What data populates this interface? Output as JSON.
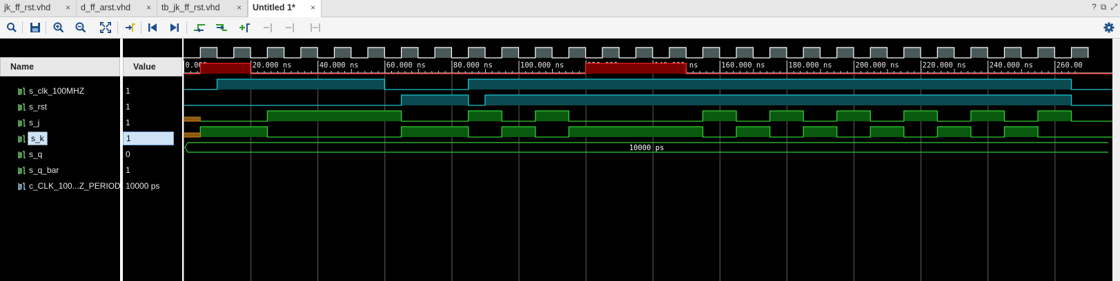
{
  "tabs": [
    {
      "label": "jk_ff_rst.vhd",
      "close": "×"
    },
    {
      "label": "d_ff_arst.vhd",
      "close": "×"
    },
    {
      "label": "tb_jk_ff_rst.vhd",
      "close": "×"
    },
    {
      "label": "Untitled 1*",
      "close": "×"
    }
  ],
  "window_controls": {
    "help": "?",
    "restore": "⧉",
    "float": "⤢"
  },
  "toolbar_icons": [
    "search-icon",
    "save-icon",
    "zoom-in-icon",
    "zoom-out-icon",
    "zoom-fit-icon",
    "go-to-cursor-icon",
    "go-to-start-icon",
    "go-to-end-icon",
    "previous-transition-icon",
    "next-transition-icon",
    "add-marker-icon",
    "previous-marker-icon",
    "next-marker-icon",
    "swap-cursors-icon",
    "settings-gear-icon"
  ],
  "columns": {
    "name": "Name",
    "value": "Value"
  },
  "signals": [
    {
      "name": "s_clk_100MHZ",
      "value": "1"
    },
    {
      "name": "s_rst",
      "value": "1"
    },
    {
      "name": "s_j",
      "value": "1"
    },
    {
      "name": "s_k",
      "value": "1"
    },
    {
      "name": "s_q",
      "value": "0"
    },
    {
      "name": "s_q_bar",
      "value": "1"
    },
    {
      "name": "c_CLK_100...Z_PERIOD",
      "value": "10000 ps"
    }
  ],
  "timeline": {
    "unit": "ns",
    "ticks": [
      "0.000 ns",
      "20.000 ns",
      "40.000 ns",
      "60.000 ns",
      "80.000 ns",
      "100.000 ns",
      "120.000 ns",
      "140.000 ns",
      "160.000 ns",
      "180.000 ns",
      "200.000 ns",
      "220.000 ns",
      "240.000 ns",
      "260.00"
    ],
    "tick_values": [
      0,
      20,
      40,
      60,
      80,
      100,
      120,
      140,
      160,
      180,
      200,
      220,
      240,
      260
    ],
    "visible_range_ns": [
      0,
      265
    ]
  },
  "waveforms": {
    "clock_period_ns": 10,
    "s_rst_high_ns": [
      [
        5,
        20
      ],
      [
        120,
        150
      ]
    ],
    "s_j_high_ns": [
      [
        10,
        60
      ],
      [
        85,
        265
      ]
    ],
    "s_k_high_ns": [
      [
        65,
        85
      ],
      [
        90,
        265
      ]
    ],
    "s_q_high_ns": [
      [
        25,
        65
      ],
      [
        85,
        95
      ],
      [
        105,
        115
      ],
      [
        155,
        165
      ],
      [
        175,
        185
      ],
      [
        195,
        205
      ],
      [
        215,
        225
      ],
      [
        235,
        245
      ],
      [
        255,
        265
      ]
    ],
    "s_q_bar_high_ns": [
      [
        5,
        25
      ],
      [
        65,
        85
      ],
      [
        95,
        105
      ],
      [
        115,
        155
      ],
      [
        165,
        175
      ],
      [
        185,
        195
      ],
      [
        205,
        215
      ],
      [
        225,
        235
      ],
      [
        245,
        255
      ]
    ],
    "undefined_until_ns": 5,
    "const_label": "10000 ps"
  },
  "colors": {
    "clk": "#4a5a5a",
    "rst": "#ff2020",
    "rst_fill": "#7a0000",
    "j_k": "#18c8d0",
    "j_k_fill": "#0a4a50",
    "q": "#30d030",
    "q_fill": "#0a5a10",
    "undefined": "#c88020",
    "grid": "#606060"
  }
}
